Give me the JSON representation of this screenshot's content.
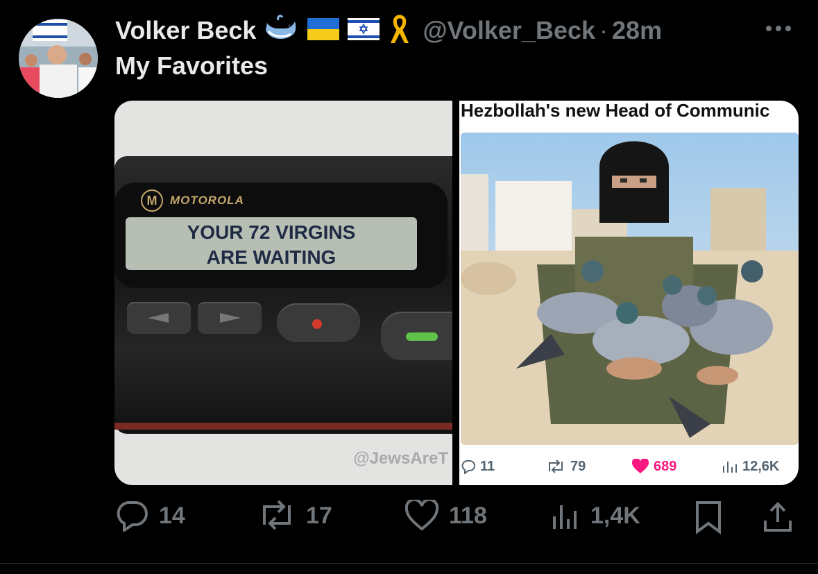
{
  "post": {
    "author_name": "Volker Beck",
    "handle": "@Volker_Beck",
    "separator": "·",
    "time": "28m",
    "text": "My Favorites",
    "more_icon": "more-horizontal-icon"
  },
  "media": {
    "left": {
      "brand": "MOTOROLA",
      "brand_logo": "M",
      "screen_line1": "YOUR 72 VIRGINS",
      "screen_line2": "ARE WAITING",
      "watermark": "@JewsAreT"
    },
    "right": {
      "headline": "Hezbollah's new Head of Communic",
      "stats": {
        "replies": "11",
        "reposts": "79",
        "likes": "689",
        "views": "12,6K"
      }
    }
  },
  "actions": {
    "replies": "14",
    "reposts": "17",
    "likes": "118",
    "views": "1,4K"
  },
  "colors": {
    "background": "#000000",
    "text_primary": "#e7e9ea",
    "text_secondary": "#71767b",
    "like_pink": "#f91880"
  }
}
